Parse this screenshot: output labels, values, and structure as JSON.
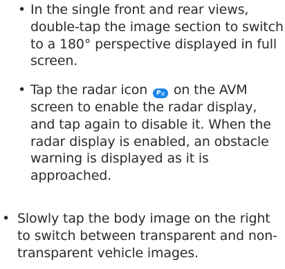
{
  "bullet_char": "•",
  "sub_items": [
    {
      "text": "In the single front and rear views, double-tap the image section to switch to a 180° perspective displayed in full screen."
    },
    {
      "text_before": "Tap the radar icon",
      "icon_name": "radar-icon",
      "icon_color": "#1a84e8",
      "text_after": "on the AVM screen to enable the radar display, and tap again to disable it. When the radar display is enabled, an obstacle warning is displayed as it is approached."
    }
  ],
  "main_items": [
    {
      "text": "Slowly tap the body image on the right to switch between transparent and non-transparent vehicle images."
    }
  ]
}
